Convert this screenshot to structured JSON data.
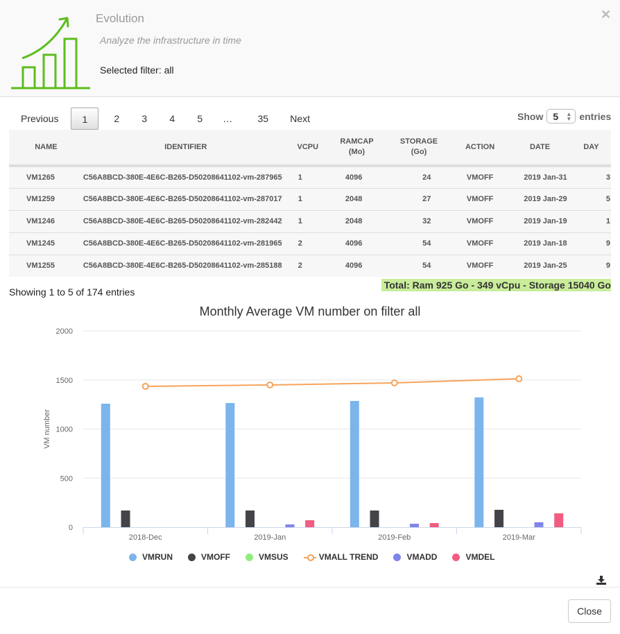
{
  "header": {
    "title": "Evolution",
    "subtitle": "Analyze the infrastructure in time",
    "filter": "Selected filter: all",
    "logo_icon": "growth-chart-icon",
    "accent_color": "#5cbd1c"
  },
  "pagination": {
    "previous": "Previous",
    "pages": [
      "1",
      "2",
      "3",
      "4",
      "5"
    ],
    "ellipsis": "…",
    "last": "35",
    "next": "Next",
    "active": "1"
  },
  "length": {
    "show": "Show",
    "value": "5",
    "entries": "entries"
  },
  "table": {
    "headers": {
      "name": "NAME",
      "identifier": "IDENTIFIER",
      "vcpu": "VCPU",
      "ramcap": "RAMCAP",
      "ramcap_unit": "(Mo)",
      "storage": "STORAGE",
      "storage_unit": "(Go)",
      "action": "ACTION",
      "date": "DATE",
      "day": "DAY"
    },
    "rows": [
      {
        "name": "VM1265",
        "identifier": "C56A8BCD-380E-4E6C-B265-D50208641102-vm-287965",
        "vcpu": "1",
        "ramcap": "4096",
        "storage": "24",
        "action": "VMOFF",
        "date": "2019 Jan-31",
        "day": "3"
      },
      {
        "name": "VM1259",
        "identifier": "C56A8BCD-380E-4E6C-B265-D50208641102-vm-287017",
        "vcpu": "1",
        "ramcap": "2048",
        "storage": "27",
        "action": "VMOFF",
        "date": "2019 Jan-29",
        "day": "5"
      },
      {
        "name": "VM1246",
        "identifier": "C56A8BCD-380E-4E6C-B265-D50208641102-vm-282442",
        "vcpu": "1",
        "ramcap": "2048",
        "storage": "32",
        "action": "VMOFF",
        "date": "2019 Jan-19",
        "day": "1"
      },
      {
        "name": "VM1245",
        "identifier": "C56A8BCD-380E-4E6C-B265-D50208641102-vm-281965",
        "vcpu": "2",
        "ramcap": "4096",
        "storage": "54",
        "action": "VMOFF",
        "date": "2019 Jan-18",
        "day": "9"
      },
      {
        "name": "VM1255",
        "identifier": "C56A8BCD-380E-4E6C-B265-D50208641102-vm-285188",
        "vcpu": "2",
        "ramcap": "4096",
        "storage": "54",
        "action": "VMOFF",
        "date": "2019 Jan-25",
        "day": "9"
      }
    ]
  },
  "info": "Showing 1 to 5 of 174 entries",
  "total": "Total: Ram 925 Go - 349 vCpu - Storage 15040 Go",
  "total_color": "#c9ec9b",
  "chart_data": {
    "type": "bar",
    "title": "Monthly Average VM number on filter all",
    "xlabel": "",
    "ylabel": "VM number",
    "ylim": [
      0,
      2000
    ],
    "yticks": [
      0,
      500,
      1000,
      1500,
      2000
    ],
    "grid": true,
    "legend_position": "bottom",
    "categories": [
      "2018-Dec",
      "2019-Jan",
      "2019-Feb",
      "2019-Mar"
    ],
    "series": [
      {
        "name": "VMRUN",
        "type": "bar",
        "color": "#7cb5ec",
        "values": [
          1258,
          1265,
          1286,
          1322
        ]
      },
      {
        "name": "VMOFF",
        "type": "bar",
        "color": "#434348",
        "values": [
          170,
          170,
          170,
          177
        ]
      },
      {
        "name": "VMSUS",
        "type": "bar",
        "color": "#90ed7d",
        "values": [
          0,
          0,
          0,
          0
        ]
      },
      {
        "name": "VMALL TREND",
        "type": "line",
        "color": "#f7a35c",
        "values": [
          1435,
          1449,
          1470,
          1512
        ]
      },
      {
        "name": "VMADD",
        "type": "bar",
        "color": "#8085e9",
        "values": [
          0,
          28,
          35,
          50
        ]
      },
      {
        "name": "VMDEL",
        "type": "bar",
        "color": "#f15c80",
        "values": [
          0,
          71,
          42,
          141
        ]
      }
    ]
  },
  "footer": {
    "close": "Close",
    "download_icon": "download-icon"
  }
}
